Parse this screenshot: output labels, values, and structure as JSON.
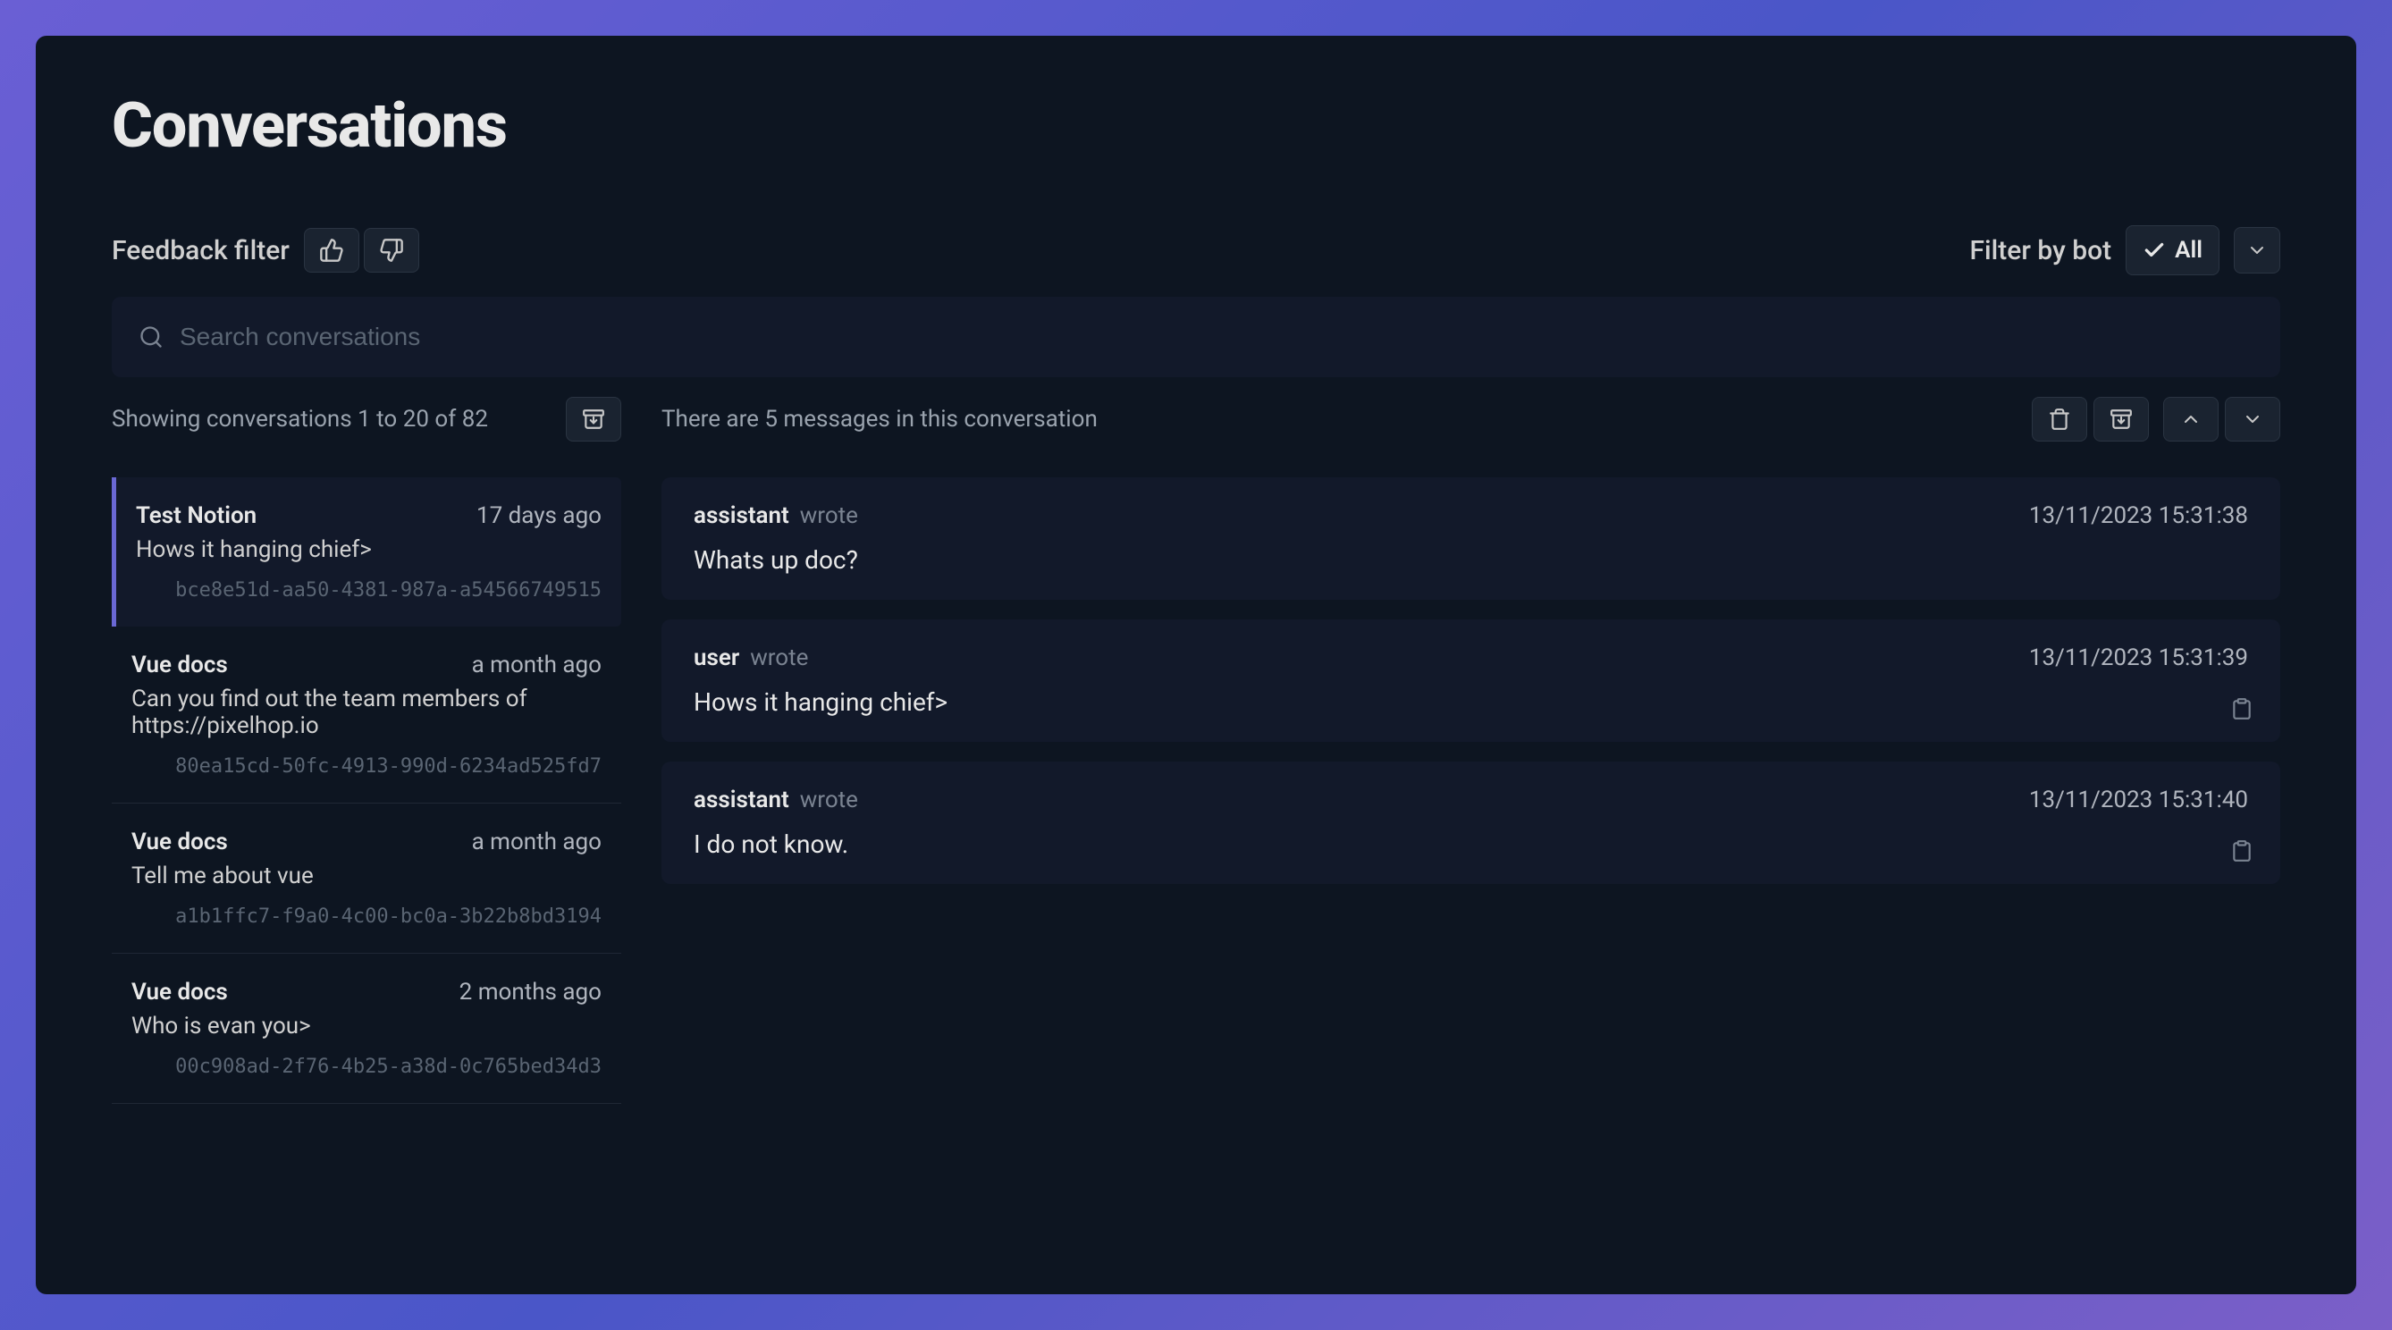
{
  "page_title": "Conversations",
  "feedback_filter_label": "Feedback filter",
  "filter_by_bot_label": "Filter by bot",
  "bot_filter_value": "All",
  "search_placeholder": "Search conversations",
  "list_summary": "Showing conversations 1 to 20 of 82",
  "messages_summary": "There are 5 messages in this conversation",
  "wrote_label": "wrote",
  "conversations": [
    {
      "bot": "Test Notion",
      "time": "17 days ago",
      "preview": "Hows it hanging chief>",
      "id": "bce8e51d-aa50-4381-987a-a54566749515",
      "selected": true
    },
    {
      "bot": "Vue docs",
      "time": "a month ago",
      "preview": "Can you find out the team members of https://pixelhop.io",
      "id": "80ea15cd-50fc-4913-990d-6234ad525fd7",
      "selected": false
    },
    {
      "bot": "Vue docs",
      "time": "a month ago",
      "preview": "Tell me about vue",
      "id": "a1b1ffc7-f9a0-4c00-bc0a-3b22b8bd3194",
      "selected": false
    },
    {
      "bot": "Vue docs",
      "time": "2 months ago",
      "preview": "Who is evan you>",
      "id": "00c908ad-2f76-4b25-a38d-0c765bed34d3",
      "selected": false
    }
  ],
  "messages": [
    {
      "role": "assistant",
      "timestamp": "13/11/2023 15:31:38",
      "body": "Whats up doc?",
      "copyable": false
    },
    {
      "role": "user",
      "timestamp": "13/11/2023 15:31:39",
      "body": "Hows it hanging chief>",
      "copyable": true
    },
    {
      "role": "assistant",
      "timestamp": "13/11/2023 15:31:40",
      "body": "I do not know.",
      "copyable": true
    }
  ]
}
